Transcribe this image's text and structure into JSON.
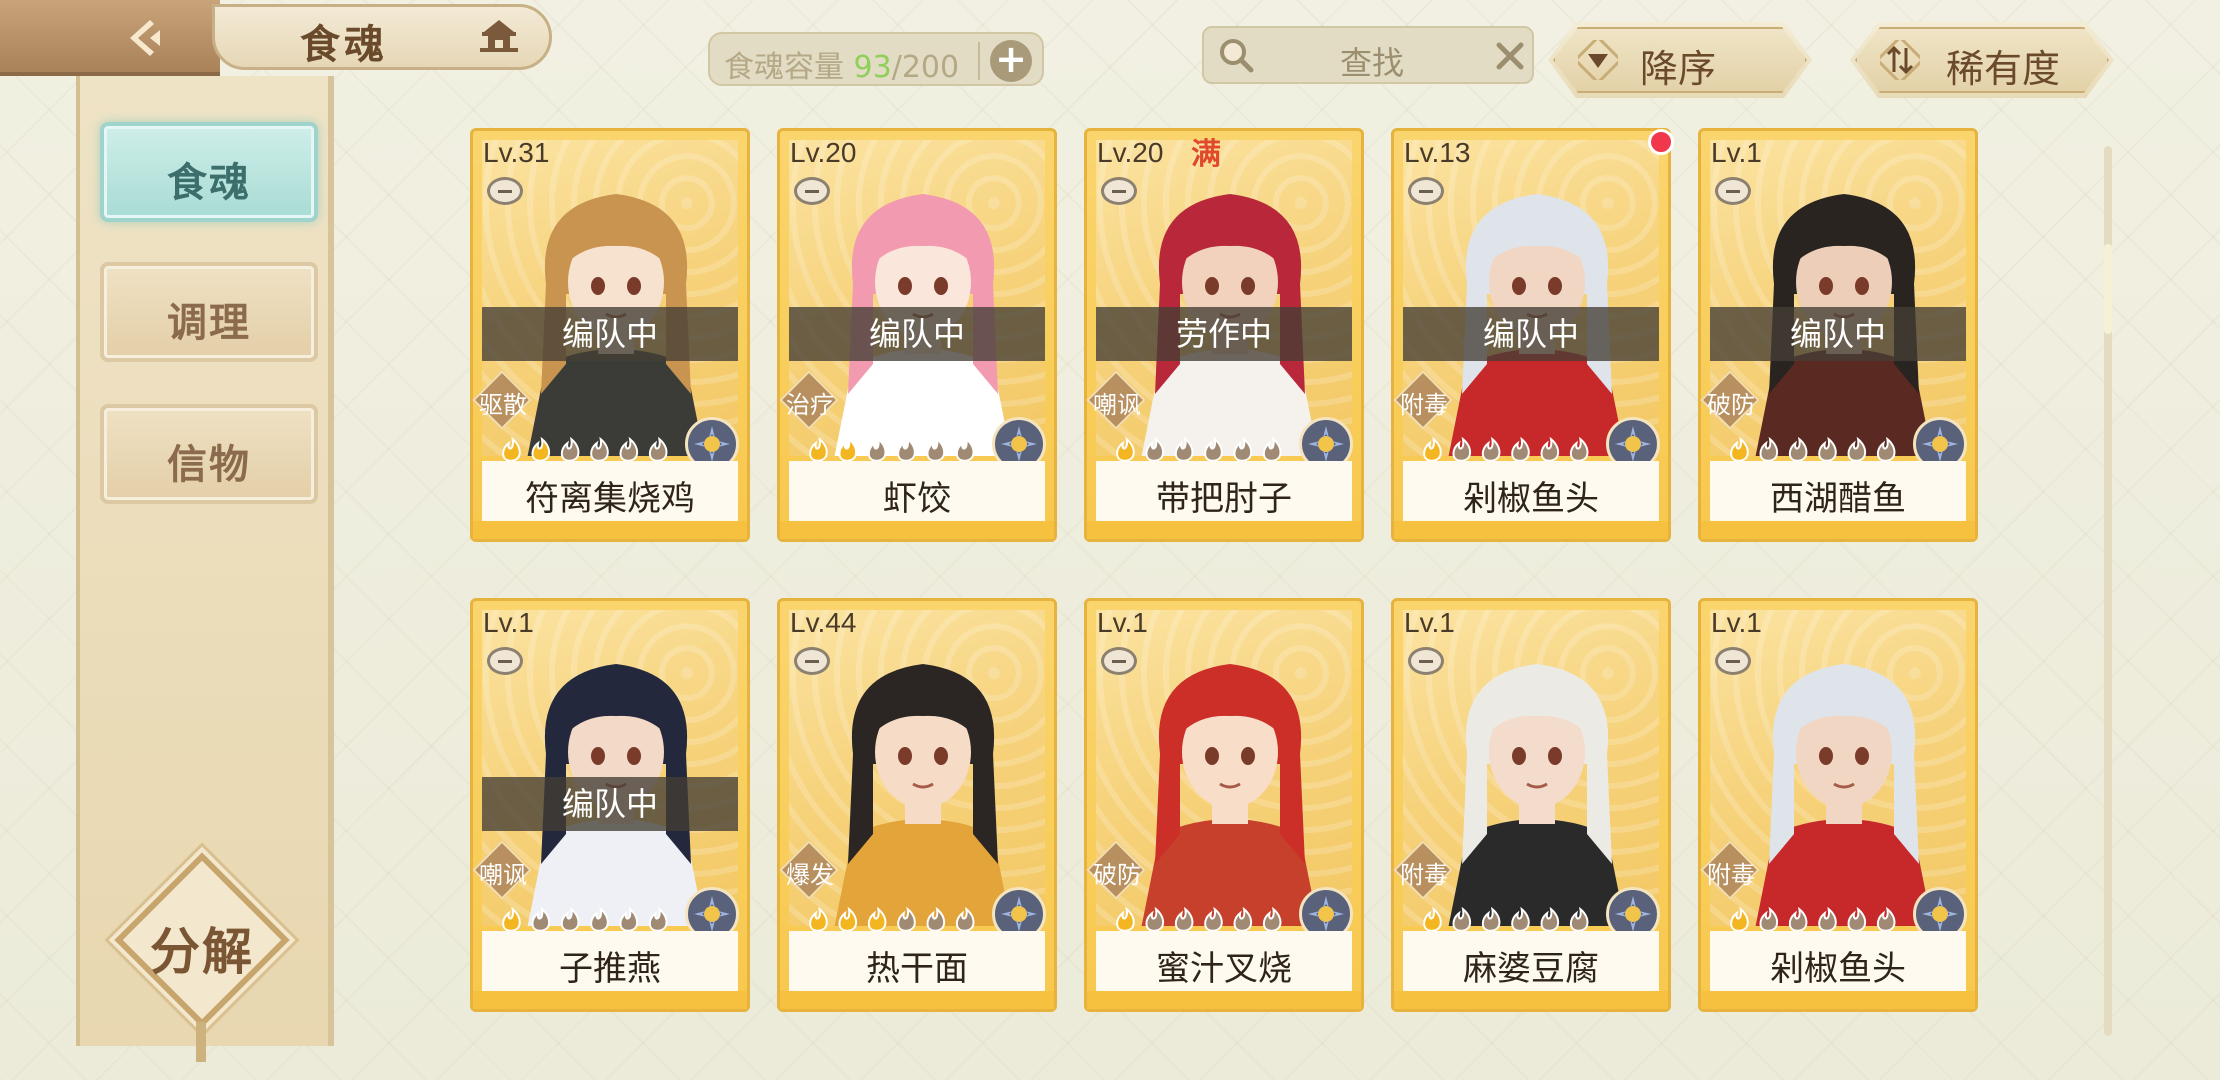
{
  "header": {
    "title": "食魂",
    "capacity_label": "食魂容量",
    "capacity_current": "93",
    "capacity_max": "/200",
    "plus_label": "+",
    "search_text": "查找",
    "sort_order_label": "降序",
    "sort_by_label": "稀有度"
  },
  "sidebar": {
    "tabs": [
      {
        "label": "食魂",
        "active": true
      },
      {
        "label": "调理",
        "active": false
      },
      {
        "label": "信物",
        "active": false
      }
    ],
    "decompose_label": "分解"
  },
  "cards": [
    {
      "level": "Lv.31",
      "status": "编队中",
      "role": "驱散",
      "name": "符离集烧鸡",
      "lit_flames": 2,
      "total_flames": 6,
      "hair": "#c8944f",
      "outfit": "#3b3b38",
      "skin": "#f7e2cf"
    },
    {
      "level": "Lv.20",
      "status": "编队中",
      "role": "治疗",
      "name": "虾饺",
      "lit_flames": 2,
      "total_flames": 6,
      "hair": "#f29ab0",
      "outfit": "#ffffff",
      "skin": "#fae6da"
    },
    {
      "level": "Lv.20",
      "status": "劳作中",
      "role": "嘲讽",
      "name": "带把肘子",
      "lit_flames": 1,
      "total_flames": 6,
      "hair": "#b8283a",
      "outfit": "#f5f2ee",
      "skin": "#f2d2bd",
      "max_tag": "满"
    },
    {
      "level": "Lv.13",
      "status": "编队中",
      "role": "附毒",
      "name": "剁椒鱼头",
      "lit_flames": 1,
      "total_flames": 6,
      "hair": "#dfe3ea",
      "outfit": "#c7292b",
      "skin": "#f2d6c4",
      "red_dot": true
    },
    {
      "level": "Lv.1",
      "status": "编队中",
      "role": "破防",
      "name": "西湖醋鱼",
      "lit_flames": 1,
      "total_flames": 6,
      "hair": "#2a2420",
      "outfit": "#5a2a22",
      "skin": "#edcfb9"
    },
    {
      "level": "Lv.1",
      "status": "编队中",
      "role": "嘲讽",
      "name": "子推燕",
      "lit_flames": 1,
      "total_flames": 6,
      "hair": "#23283c",
      "outfit": "#eef0f5",
      "skin": "#f2d9c8"
    },
    {
      "level": "Lv.44",
      "status": "",
      "role": "爆发",
      "name": "热干面",
      "lit_flames": 3,
      "total_flames": 6,
      "hair": "#2b2623",
      "outfit": "#e3a43a",
      "skin": "#f6dbc6"
    },
    {
      "level": "Lv.1",
      "status": "",
      "role": "破防",
      "name": "蜜汁叉烧",
      "lit_flames": 1,
      "total_flames": 6,
      "hair": "#cc2f28",
      "outfit": "#c7402c",
      "skin": "#f8ddc9"
    },
    {
      "level": "Lv.1",
      "status": "",
      "role": "附毒",
      "name": "麻婆豆腐",
      "lit_flames": 1,
      "total_flames": 6,
      "hair": "#eceae4",
      "outfit": "#2a2a2a",
      "skin": "#f3dccb"
    },
    {
      "level": "Lv.1",
      "status": "",
      "role": "附毒",
      "name": "剁椒鱼头",
      "lit_flames": 1,
      "total_flames": 6,
      "hair": "#dfe3ea",
      "outfit": "#c7292b",
      "skin": "#f2d6c4"
    }
  ],
  "colors": {
    "card_gold": "#f7c84d",
    "flame_lit": "#f3b621",
    "flame_dim": "#a08a74",
    "element_badge": "#59627a",
    "active_tab": "#a8dcd4"
  },
  "icons": [
    "back-arrow-icon",
    "pagoda-icon",
    "search-icon",
    "close-icon",
    "sort-down-icon",
    "sort-arrows-icon",
    "plus-icon",
    "flame-icon",
    "element-icon",
    "minus-icon"
  ]
}
